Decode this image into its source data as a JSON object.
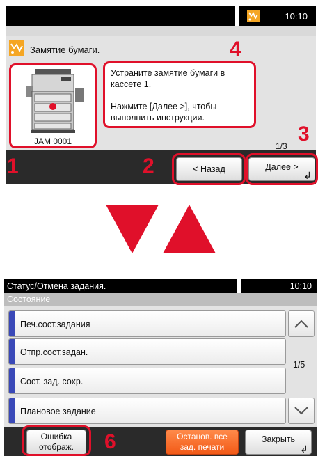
{
  "jam_screen": {
    "time": "10:10",
    "title": "Замятие бумаги.",
    "jam_code": "JAM 0001",
    "message_line1": "Устраните замятие бумаги в кассете 1.",
    "message_line2": "Нажмите [Далее >], чтобы выполнить инструкции.",
    "page_indicator": "1/3",
    "back_label": "< Назад",
    "next_label": "Далее >",
    "accent_color": "#f5a623"
  },
  "callouts": [
    "1",
    "2",
    "3",
    "4",
    "6"
  ],
  "status_screen": {
    "title": "Статус/Отмена задания.",
    "time": "10:10",
    "tab": "Состояние",
    "items": [
      {
        "label": "Печ.сост.задания"
      },
      {
        "label": "Отпр.сост.задан."
      },
      {
        "label": "Сост. зад. сохр."
      },
      {
        "label": "Плановое задание"
      }
    ],
    "page_indicator": "1/5",
    "error_button_line1": "Ошибка",
    "error_button_line2": "отображ.",
    "stop_button_line1": "Останов. все",
    "stop_button_line2": "зад. печати",
    "close_label": "Закрыть",
    "stop_color": "#f25a17",
    "item_accent_color": "#3a49b8"
  },
  "annotation_color": "#e0102a"
}
